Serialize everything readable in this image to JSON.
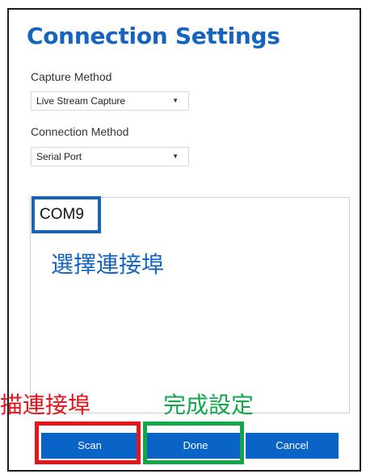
{
  "window": {
    "title": "Connection Settings"
  },
  "capture": {
    "label": "Capture Method",
    "value": "Live Stream Capture"
  },
  "connection": {
    "label": "Connection Method",
    "value": "Serial Port"
  },
  "ports": {
    "items": [
      "COM9"
    ]
  },
  "annotations": {
    "select_port": "選擇連接埠",
    "scan_port": "描連接埠",
    "finish": "完成設定"
  },
  "buttons": {
    "scan": "Scan",
    "done": "Done",
    "cancel": "Cancel"
  },
  "colors": {
    "accent": "#1565c0",
    "button": "#0a64c8",
    "annotation_red": "#e8141b",
    "annotation_green": "#12a84a",
    "annotation_blue": "#1565c0"
  }
}
